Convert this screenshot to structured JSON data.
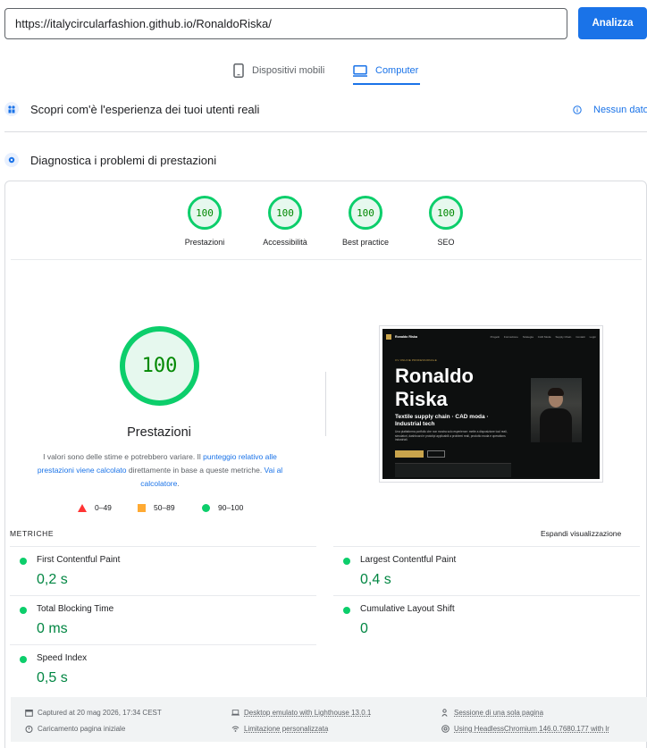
{
  "search": {
    "url": "https://italycircularfashion.github.io/RonaldoRiska/",
    "analyze_label": "Analizza"
  },
  "device_tabs": {
    "mobile": "Dispositivi mobili",
    "desktop": "Computer"
  },
  "field_data": {
    "title": "Scopri com'è l'esperienza dei tuoi utenti reali",
    "status": "Nessun dato"
  },
  "lab": {
    "title": "Diagnostica i problemi di prestazioni"
  },
  "categories": [
    {
      "score": "100",
      "label": "Prestazioni"
    },
    {
      "score": "100",
      "label": "Accessibilità"
    },
    {
      "score": "100",
      "label": "Best practice"
    },
    {
      "score": "100",
      "label": "SEO"
    }
  ],
  "main_score": {
    "score": "100",
    "label": "Prestazioni"
  },
  "description": {
    "text1": "I valori sono delle stime e potrebbero variare. Il ",
    "link1": "punteggio relativo alle prestazioni viene calcolato",
    "text2": " direttamente in base a queste metriche. ",
    "link2": "Vai al calcolatore",
    "text3": "."
  },
  "legend": {
    "fail": "0–49",
    "average": "50–89",
    "pass": "90–100"
  },
  "screenshot": {
    "brand": "Ronaldo Riska",
    "nav": [
      "Progetti",
      "Formazione",
      "Strategia",
      "CAD Moda",
      "Supply Chain",
      "Contatti",
      "Login"
    ],
    "kicker": "CV ONLINE PROFESSIONALE",
    "name": "Ronaldo Riska",
    "subtitle": "Textile supply chain · CAD moda · Industrial tech",
    "body": "Una piattaforma portfolio che non mostra solo esperienze: mette a disposizione tool reali, simulatori, dashboard e prototipi applicabili a problemi reali, prodotto moda e operations industriali."
  },
  "metrics": {
    "header": "METRICHE",
    "expand": "Espandi visualizzazione",
    "items": [
      {
        "name": "First Contentful Paint",
        "value": "0,2 s"
      },
      {
        "name": "Largest Contentful Paint",
        "value": "0,4 s"
      },
      {
        "name": "Total Blocking Time",
        "value": "0 ms"
      },
      {
        "name": "Cumulative Layout Shift",
        "value": "0"
      },
      {
        "name": "Speed Index",
        "value": "0,5 s"
      }
    ]
  },
  "footer": {
    "captured": "Captured at 20 mag 2026, 17:34 CEST",
    "load": "Caricamento pagina iniziale",
    "emulated": "Desktop emulato with Lighthouse 13.0.1",
    "throttling": "Limitazione personalizzata",
    "session": "Sessione di una sola pagina",
    "browser": "Using HeadlessChromium 146.0.7680.177 with lr"
  },
  "colors": {
    "accent": "#1a73e8",
    "pass": "#0cce6b",
    "pass_text": "#018642",
    "average": "#ffaa33",
    "fail": "#ff3333"
  }
}
